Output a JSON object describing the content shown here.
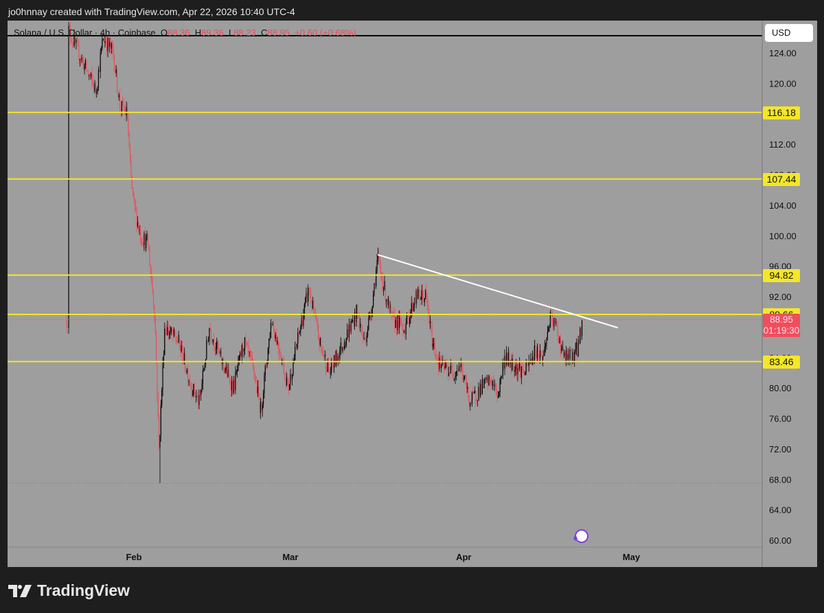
{
  "header": {
    "attribution": "jo0hnnay created with TradingView.com, Apr 22, 2026 10:40 UTC-4"
  },
  "legend": {
    "symbol": "Solana / U.S. Dollar · 4h · Coinbase",
    "o_label": "O",
    "o": "88.36",
    "h_label": "H",
    "h": "89.36",
    "l_label": "L",
    "l": "88.23",
    "c_label": "C",
    "c": "88.95",
    "change": "+0.60 (+0.68%)"
  },
  "currency": "USD",
  "current": {
    "price": "88.95",
    "countdown": "01:19:30"
  },
  "footer": {
    "brand": "TradingView"
  },
  "colors": {
    "up": "#000000",
    "down": "#e8505b",
    "level": "#f5e628",
    "bg": "#9e9e9e"
  },
  "chart_data": {
    "type": "candlestick",
    "title": "Solana / U.S. Dollar · 4h · Coinbase",
    "ylim": [
      58,
      128
    ],
    "yticks": [
      124,
      120,
      116,
      112,
      108,
      104,
      100,
      96,
      92,
      88,
      84,
      80,
      76,
      72,
      68,
      64,
      60
    ],
    "xticks": [
      {
        "label": "Feb",
        "day": 0
      },
      {
        "label": "Mar",
        "day": 28
      },
      {
        "label": "Apr",
        "day": 59
      },
      {
        "label": "May",
        "day": 89
      }
    ],
    "close_path_day_price": [
      [
        -11.7,
        127
      ],
      [
        -6.8,
        119
      ],
      [
        -5.5,
        126
      ],
      [
        -3.7,
        124
      ],
      [
        -2.5,
        117
      ],
      [
        -1.2,
        116
      ],
      [
        -0.6,
        108
      ],
      [
        0,
        104
      ],
      [
        1.2,
        100
      ],
      [
        2.5,
        99
      ],
      [
        3.7,
        90
      ],
      [
        4.5,
        72
      ],
      [
        5.5,
        88
      ],
      [
        8,
        86
      ],
      [
        10.4,
        80
      ],
      [
        11.7,
        78
      ],
      [
        13.5,
        88
      ],
      [
        15.4,
        84
      ],
      [
        17.8,
        80
      ],
      [
        19.7,
        86
      ],
      [
        21.5,
        82
      ],
      [
        22.7,
        77
      ],
      [
        24.6,
        89
      ],
      [
        26.4,
        84
      ],
      [
        27.6,
        80
      ],
      [
        29.5,
        87
      ],
      [
        31.3,
        93
      ],
      [
        33.2,
        86
      ],
      [
        35,
        82
      ],
      [
        37.5,
        86
      ],
      [
        39.9,
        90
      ],
      [
        41.2,
        86
      ],
      [
        42.4,
        90
      ],
      [
        43.6,
        97
      ],
      [
        44.8,
        93
      ],
      [
        46.1,
        89
      ],
      [
        48.5,
        88
      ],
      [
        50.4,
        92
      ],
      [
        52.2,
        92
      ],
      [
        53.4,
        86
      ],
      [
        54.7,
        83
      ],
      [
        57.1,
        82
      ],
      [
        58.4,
        83
      ],
      [
        60.2,
        78
      ],
      [
        62,
        80
      ],
      [
        63.9,
        81
      ],
      [
        65.1,
        79
      ],
      [
        66.3,
        84
      ],
      [
        68.2,
        83
      ],
      [
        70,
        82
      ],
      [
        71.9,
        85
      ],
      [
        73.2,
        84
      ],
      [
        74.4,
        89
      ],
      [
        75.6,
        88
      ],
      [
        76.9,
        84
      ],
      [
        78.1,
        84
      ],
      [
        79.3,
        85
      ],
      [
        80.3,
        88.95
      ]
    ],
    "low_marker": 67.5,
    "levels": [
      {
        "price": 116.18,
        "label": "116.18"
      },
      {
        "price": 107.44,
        "label": "107.44"
      },
      {
        "price": 94.82,
        "label": "94.82"
      },
      {
        "price": 89.66,
        "label": "89.66"
      },
      {
        "price": 83.46,
        "label": "83.46"
      }
    ],
    "top_line": 126.25,
    "trendline": {
      "from": [
        43.6,
        97.5
      ],
      "to": [
        86.6,
        87.9
      ]
    }
  }
}
